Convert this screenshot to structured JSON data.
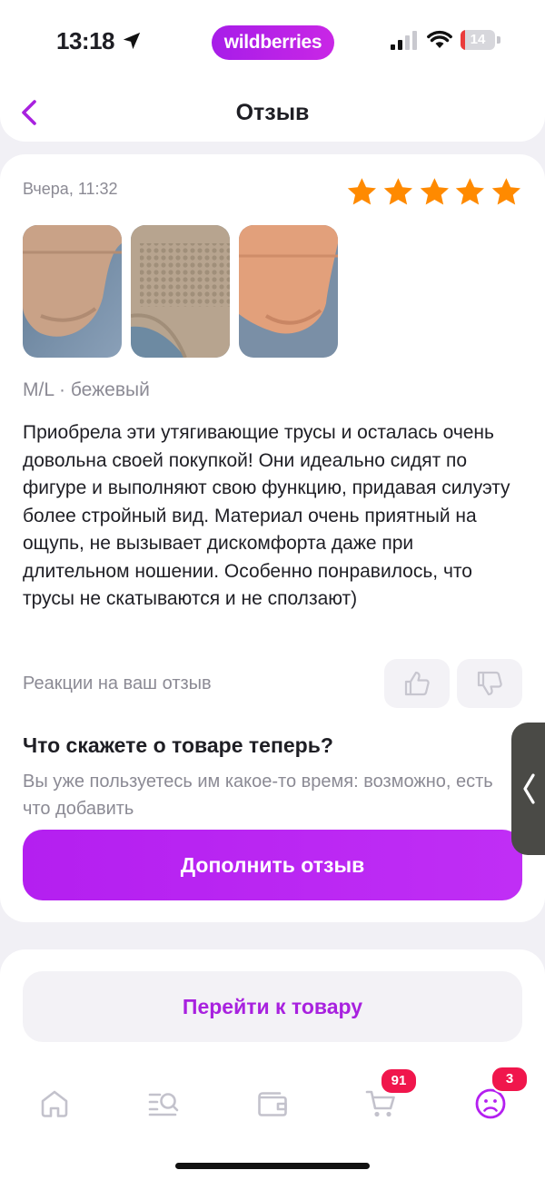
{
  "status_bar": {
    "time": "13:18",
    "app_badge": "wildberries",
    "battery_level": "14",
    "battery_fraction": 0.14
  },
  "header": {
    "title": "Отзыв"
  },
  "review": {
    "date": "Вчера, 11:32",
    "rating": 5,
    "rating_max": 5,
    "meta": "M/L · бежевый",
    "text": "Приобрела эти утягивающие трусы и осталась очень довольна своей покупкой! Они идеально сидят по фигуре и выполняют свою функцию, придавая силуэту более стройный вид. Материал очень приятный на ощупь, не вызывает дискомфорта даже при длительном ношении. Особенно понравилось, что трусы не скатываются и не сползают)",
    "photos": [
      "review-photo-1",
      "review-photo-2",
      "review-photo-3"
    ],
    "reactions_label": "Реакции на ваш отзыв"
  },
  "add_review": {
    "title": "Что скажете о товаре теперь?",
    "subtitle": "Вы уже пользуетесь им какое-то время: возможно, есть что добавить",
    "button": "Дополнить отзыв"
  },
  "goto_product": {
    "button": "Перейти к товару"
  },
  "tabbar": {
    "items": [
      {
        "icon": "home-icon"
      },
      {
        "icon": "catalog-search-icon"
      },
      {
        "icon": "wallet-icon"
      },
      {
        "icon": "cart-icon",
        "badge": "91"
      },
      {
        "icon": "profile-icon",
        "badge": "3"
      }
    ]
  },
  "colors": {
    "accent": "#b41ff0",
    "star": "#ff8a00",
    "badge": "#f0164c"
  }
}
